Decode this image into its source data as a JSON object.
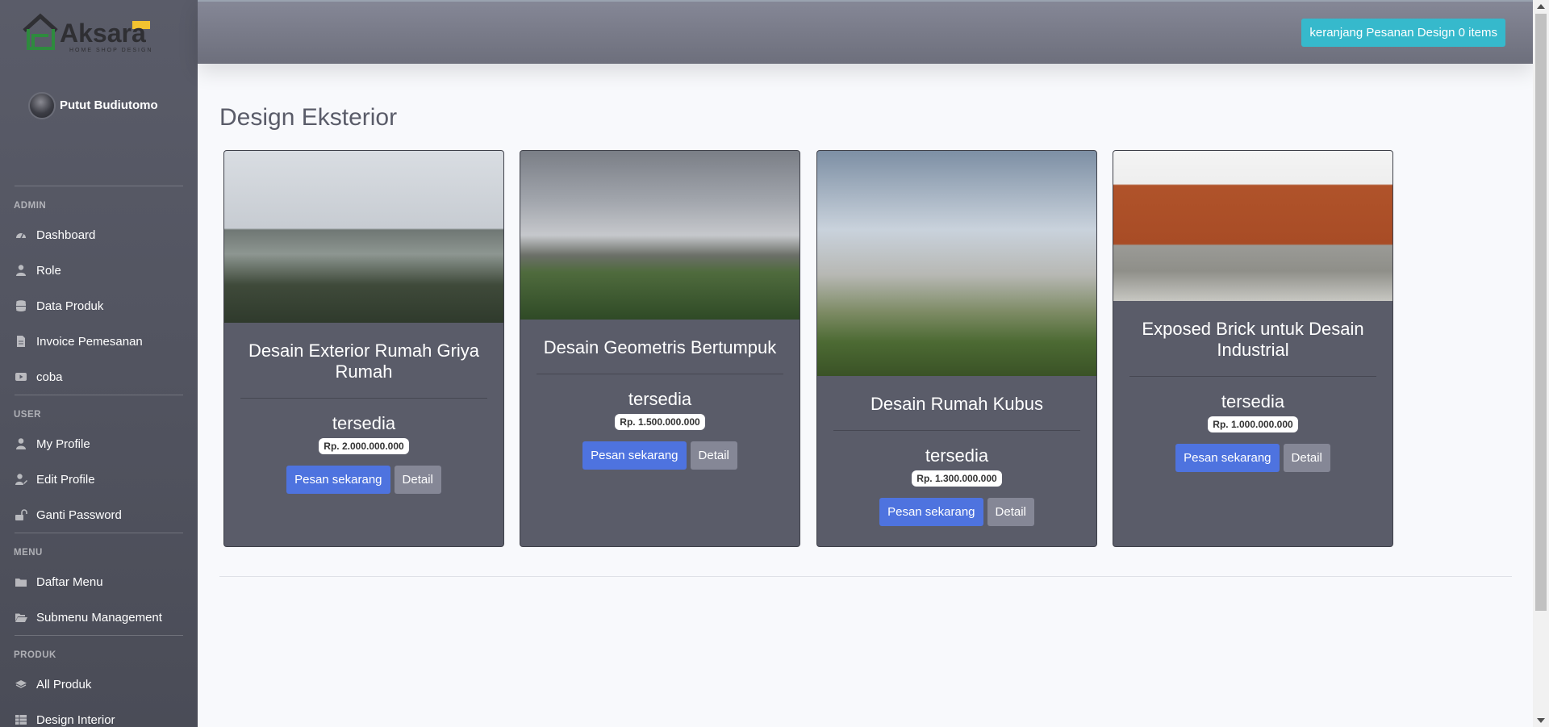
{
  "brand": {
    "name": "Aksara",
    "tagline": "HOME SHOP DESIGN"
  },
  "user": {
    "name": "Putut Budiutomo"
  },
  "sidebar": {
    "sections": [
      {
        "heading": "ADMIN",
        "items": [
          {
            "label": "Dashboard",
            "icon": "dashboard-icon"
          },
          {
            "label": "Role",
            "icon": "user-tie-icon"
          },
          {
            "label": "Data Produk",
            "icon": "database-icon"
          },
          {
            "label": "Invoice Pemesanan",
            "icon": "file-icon"
          },
          {
            "label": "coba",
            "icon": "youtube-icon"
          }
        ]
      },
      {
        "heading": "USER",
        "items": [
          {
            "label": "My Profile",
            "icon": "user-icon"
          },
          {
            "label": "Edit Profile",
            "icon": "user-edit-icon"
          },
          {
            "label": "Ganti Password",
            "icon": "unlock-icon"
          }
        ]
      },
      {
        "heading": "MENU",
        "items": [
          {
            "label": "Daftar Menu",
            "icon": "folder-icon"
          },
          {
            "label": "Submenu Management",
            "icon": "folder-open-icon"
          }
        ]
      },
      {
        "heading": "PRODUK",
        "items": [
          {
            "label": "All Produk",
            "icon": "layers-icon"
          },
          {
            "label": "Design Interior",
            "icon": "table-icon"
          }
        ]
      }
    ]
  },
  "topbar": {
    "cart_label": "keranjang Pesanan Design 0 items"
  },
  "page": {
    "title": "Design Eksterior"
  },
  "products": [
    {
      "title": "Desain Exterior Rumah Griya Rumah",
      "status": "tersedia",
      "price": "Rp. 2.000.000.000",
      "order_label": "Pesan sekarang",
      "detail_label": "Detail"
    },
    {
      "title": "Desain Geometris Bertumpuk",
      "status": "tersedia",
      "price": "Rp. 1.500.000.000",
      "order_label": "Pesan sekarang",
      "detail_label": "Detail"
    },
    {
      "title": "Desain Rumah Kubus",
      "status": "tersedia",
      "price": "Rp. 1.300.000.000",
      "order_label": "Pesan sekarang",
      "detail_label": "Detail"
    },
    {
      "title": "Exposed Brick untuk Desain Industrial",
      "status": "tersedia",
      "price": "Rp. 1.000.000.000",
      "order_label": "Pesan sekarang",
      "detail_label": "Detail"
    }
  ],
  "colors": {
    "sidebar": "#5a5c69",
    "cart_button": "#36b9cc",
    "primary_button": "#4e73df",
    "secondary_button": "#858796",
    "card": "#5a5c69"
  }
}
